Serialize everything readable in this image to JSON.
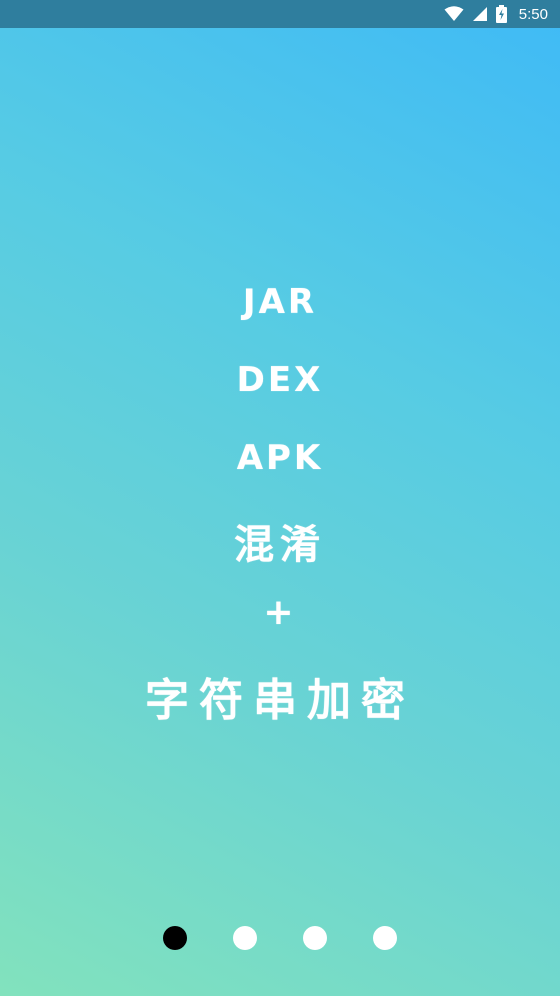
{
  "status_bar": {
    "time": "5:50",
    "icons": [
      "wifi-icon",
      "signal-icon",
      "battery-charging-icon"
    ]
  },
  "slide": {
    "lines": [
      "JAR",
      "DEX",
      "APK",
      "混淆",
      "+",
      "字符串加密"
    ]
  },
  "pager": {
    "count": 4,
    "active_index": 0
  },
  "colors": {
    "gradient_top": "#3fbaf6",
    "gradient_bottom": "#82e2bd",
    "status_bar": "#2f7e9e",
    "text": "#ffffff",
    "active_dot": "#000000",
    "inactive_dot": "#ffffff"
  }
}
